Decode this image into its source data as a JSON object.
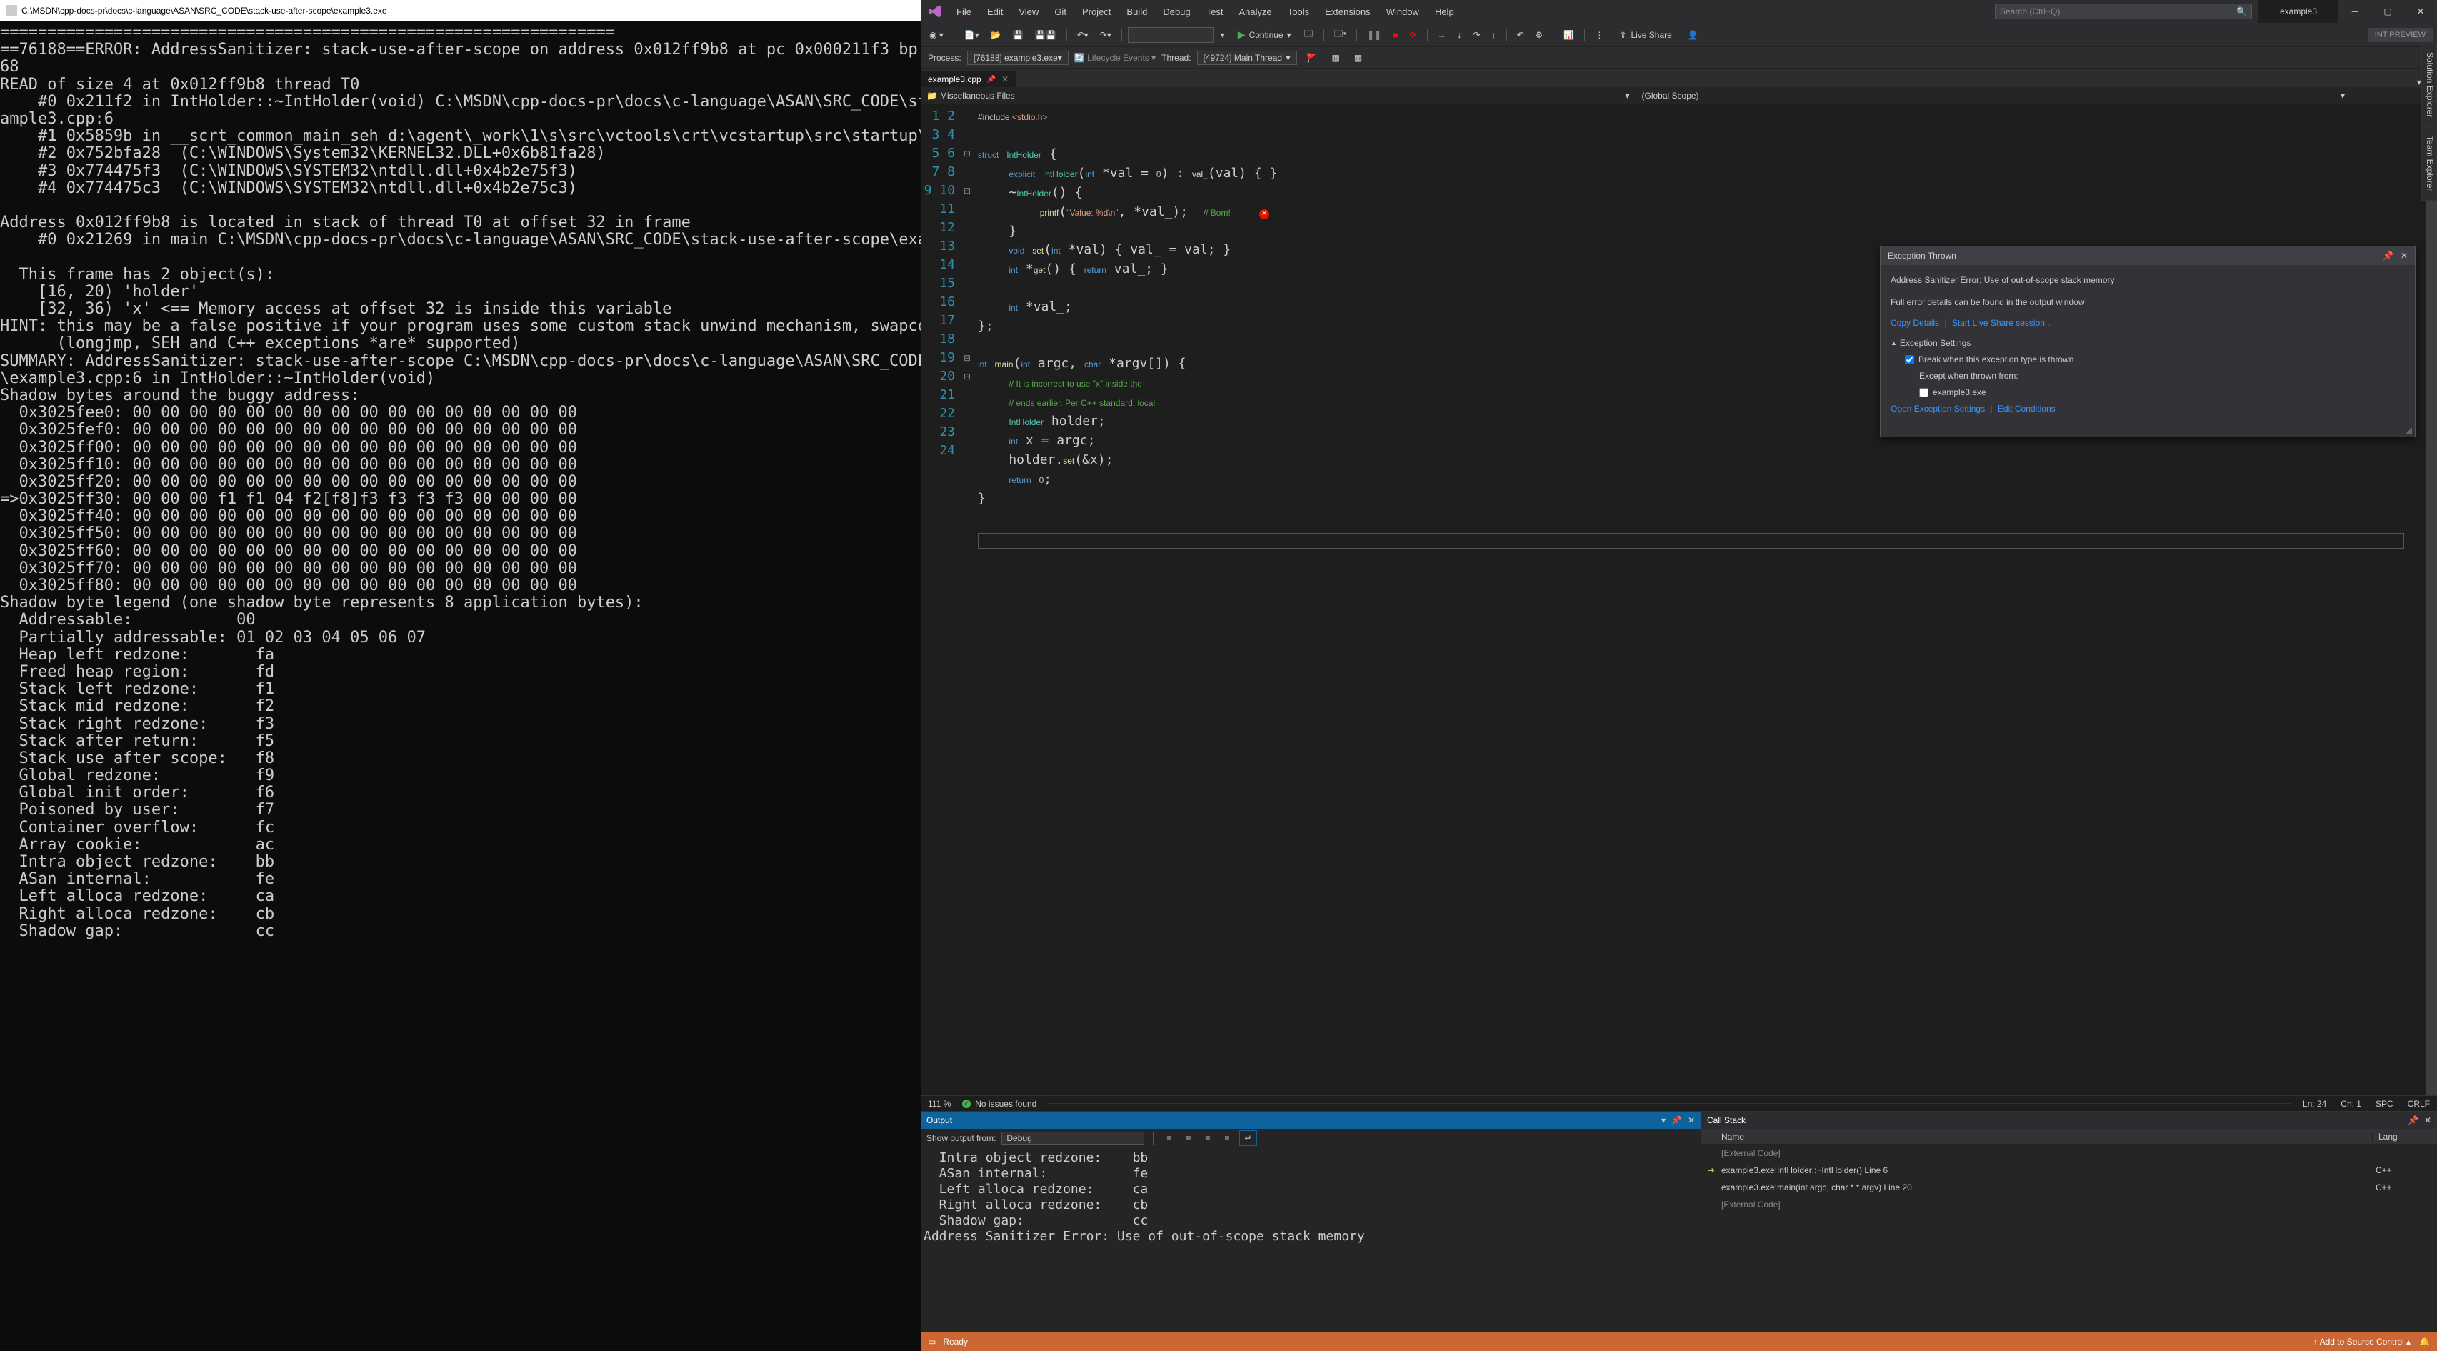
{
  "console": {
    "title": "C:\\MSDN\\cpp-docs-pr\\docs\\c-language\\ASAN\\SRC_CODE\\stack-use-after-scope\\example3.exe",
    "text": "=================================================================\n==76188==ERROR: AddressSanitizer: stack-use-after-scope on address 0x012ff9b8 at pc 0x000211f3 bp\n68\nREAD of size 4 at 0x012ff9b8 thread T0\n    #0 0x211f2 in IntHolder::~IntHolder(void) C:\\MSDN\\cpp-docs-pr\\docs\\c-language\\ASAN\\SRC_CODE\\st\nample3.cpp:6\n    #1 0x5859b in __scrt_common_main_seh d:\\agent\\_work\\1\\s\\src\\vctools\\crt\\vcstartup\\src\\startup\\e\n    #2 0x752bfa28  (C:\\WINDOWS\\System32\\KERNEL32.DLL+0x6b81fa28)\n    #3 0x774475f3  (C:\\WINDOWS\\SYSTEM32\\ntdll.dll+0x4b2e75f3)\n    #4 0x774475c3  (C:\\WINDOWS\\SYSTEM32\\ntdll.dll+0x4b2e75c3)\n\nAddress 0x012ff9b8 is located in stack of thread T0 at offset 32 in frame\n    #0 0x21269 in main C:\\MSDN\\cpp-docs-pr\\docs\\c-language\\ASAN\\SRC_CODE\\stack-use-after-scope\\exa\n\n  This frame has 2 object(s):\n    [16, 20) 'holder'\n    [32, 36) 'x' <== Memory access at offset 32 is inside this variable\nHINT: this may be a false positive if your program uses some custom stack unwind mechanism, swapco\n      (longjmp, SEH and C++ exceptions *are* supported)\nSUMMARY: AddressSanitizer: stack-use-after-scope C:\\MSDN\\cpp-docs-pr\\docs\\c-language\\ASAN\\SRC_CODE\n\\example3.cpp:6 in IntHolder::~IntHolder(void)\nShadow bytes around the buggy address:\n  0x3025fee0: 00 00 00 00 00 00 00 00 00 00 00 00 00 00 00 00\n  0x3025fef0: 00 00 00 00 00 00 00 00 00 00 00 00 00 00 00 00\n  0x3025ff00: 00 00 00 00 00 00 00 00 00 00 00 00 00 00 00 00\n  0x3025ff10: 00 00 00 00 00 00 00 00 00 00 00 00 00 00 00 00\n  0x3025ff20: 00 00 00 00 00 00 00 00 00 00 00 00 00 00 00 00\n=>0x3025ff30: 00 00 00 f1 f1 04 f2[f8]f3 f3 f3 f3 00 00 00 00\n  0x3025ff40: 00 00 00 00 00 00 00 00 00 00 00 00 00 00 00 00\n  0x3025ff50: 00 00 00 00 00 00 00 00 00 00 00 00 00 00 00 00\n  0x3025ff60: 00 00 00 00 00 00 00 00 00 00 00 00 00 00 00 00\n  0x3025ff70: 00 00 00 00 00 00 00 00 00 00 00 00 00 00 00 00\n  0x3025ff80: 00 00 00 00 00 00 00 00 00 00 00 00 00 00 00 00\nShadow byte legend (one shadow byte represents 8 application bytes):\n  Addressable:           00\n  Partially addressable: 01 02 03 04 05 06 07\n  Heap left redzone:       fa\n  Freed heap region:       fd\n  Stack left redzone:      f1\n  Stack mid redzone:       f2\n  Stack right redzone:     f3\n  Stack after return:      f5\n  Stack use after scope:   f8\n  Global redzone:          f9\n  Global init order:       f6\n  Poisoned by user:        f7\n  Container overflow:      fc\n  Array cookie:            ac\n  Intra object redzone:    bb\n  ASan internal:           fe\n  Left alloca redzone:     ca\n  Right alloca redzone:    cb\n  Shadow gap:              cc"
  },
  "menu": {
    "file": "File",
    "edit": "Edit",
    "view": "View",
    "git": "Git",
    "project": "Project",
    "build": "Build",
    "debug": "Debug",
    "test": "Test",
    "analyze": "Analyze",
    "tools": "Tools",
    "extensions": "Extensions",
    "window": "Window",
    "help": "Help"
  },
  "search_placeholder": "Search (Ctrl+Q)",
  "solution_name": "example3",
  "continue_label": "Continue",
  "liveshare_label": "Live Share",
  "intpreview": "INT PREVIEW",
  "debug": {
    "process_lbl": "Process:",
    "process": "[76188] example3.exe",
    "lifecycle": "Lifecycle Events",
    "thread_lbl": "Thread:",
    "thread": "[49724] Main Thread"
  },
  "file_tab": "example3.cpp",
  "nav1": "Miscellaneous Files",
  "nav2": "(Global Scope)",
  "code_lines": 24,
  "exception": {
    "title": "Exception Thrown",
    "msg": "Address Sanitizer Error: Use of out-of-scope stack memory",
    "detail": "Full error details can be found in the output window",
    "copy": "Copy Details",
    "startls": "Start Live Share session...",
    "settings": "Exception Settings",
    "break": "Break when this exception type is thrown",
    "except": "Except when thrown from:",
    "exe": "example3.exe",
    "open": "Open Exception Settings",
    "editc": "Edit Conditions"
  },
  "editor_status": {
    "zoom": "111 %",
    "issues": "No issues found",
    "ln": "Ln: 24",
    "ch": "Ch: 1",
    "spc": "SPC",
    "crlf": "CRLF"
  },
  "output": {
    "title": "Output",
    "show_lbl": "Show output from:",
    "show_val": "Debug",
    "text": "  Intra object redzone:    bb\n  ASan internal:           fe\n  Left alloca redzone:     ca\n  Right alloca redzone:    cb\n  Shadow gap:              cc\nAddress Sanitizer Error: Use of out-of-scope stack memory"
  },
  "callstack": {
    "title": "Call Stack",
    "name_col": "Name",
    "lang_col": "Lang",
    "rows": [
      {
        "name": "[External Code]",
        "lang": "",
        "ext": true,
        "ico": ""
      },
      {
        "name": "example3.exe!IntHolder::~IntHolder() Line 6",
        "lang": "C++",
        "ext": false,
        "ico": "➜"
      },
      {
        "name": "example3.exe!main(int argc, char * * argv) Line 20",
        "lang": "C++",
        "ext": false,
        "ico": ""
      },
      {
        "name": "[External Code]",
        "lang": "",
        "ext": true,
        "ico": ""
      }
    ]
  },
  "side": {
    "se": "Solution Explorer",
    "te": "Team Explorer"
  },
  "status": {
    "ready": "Ready",
    "add_src": "Add to Source Control"
  }
}
